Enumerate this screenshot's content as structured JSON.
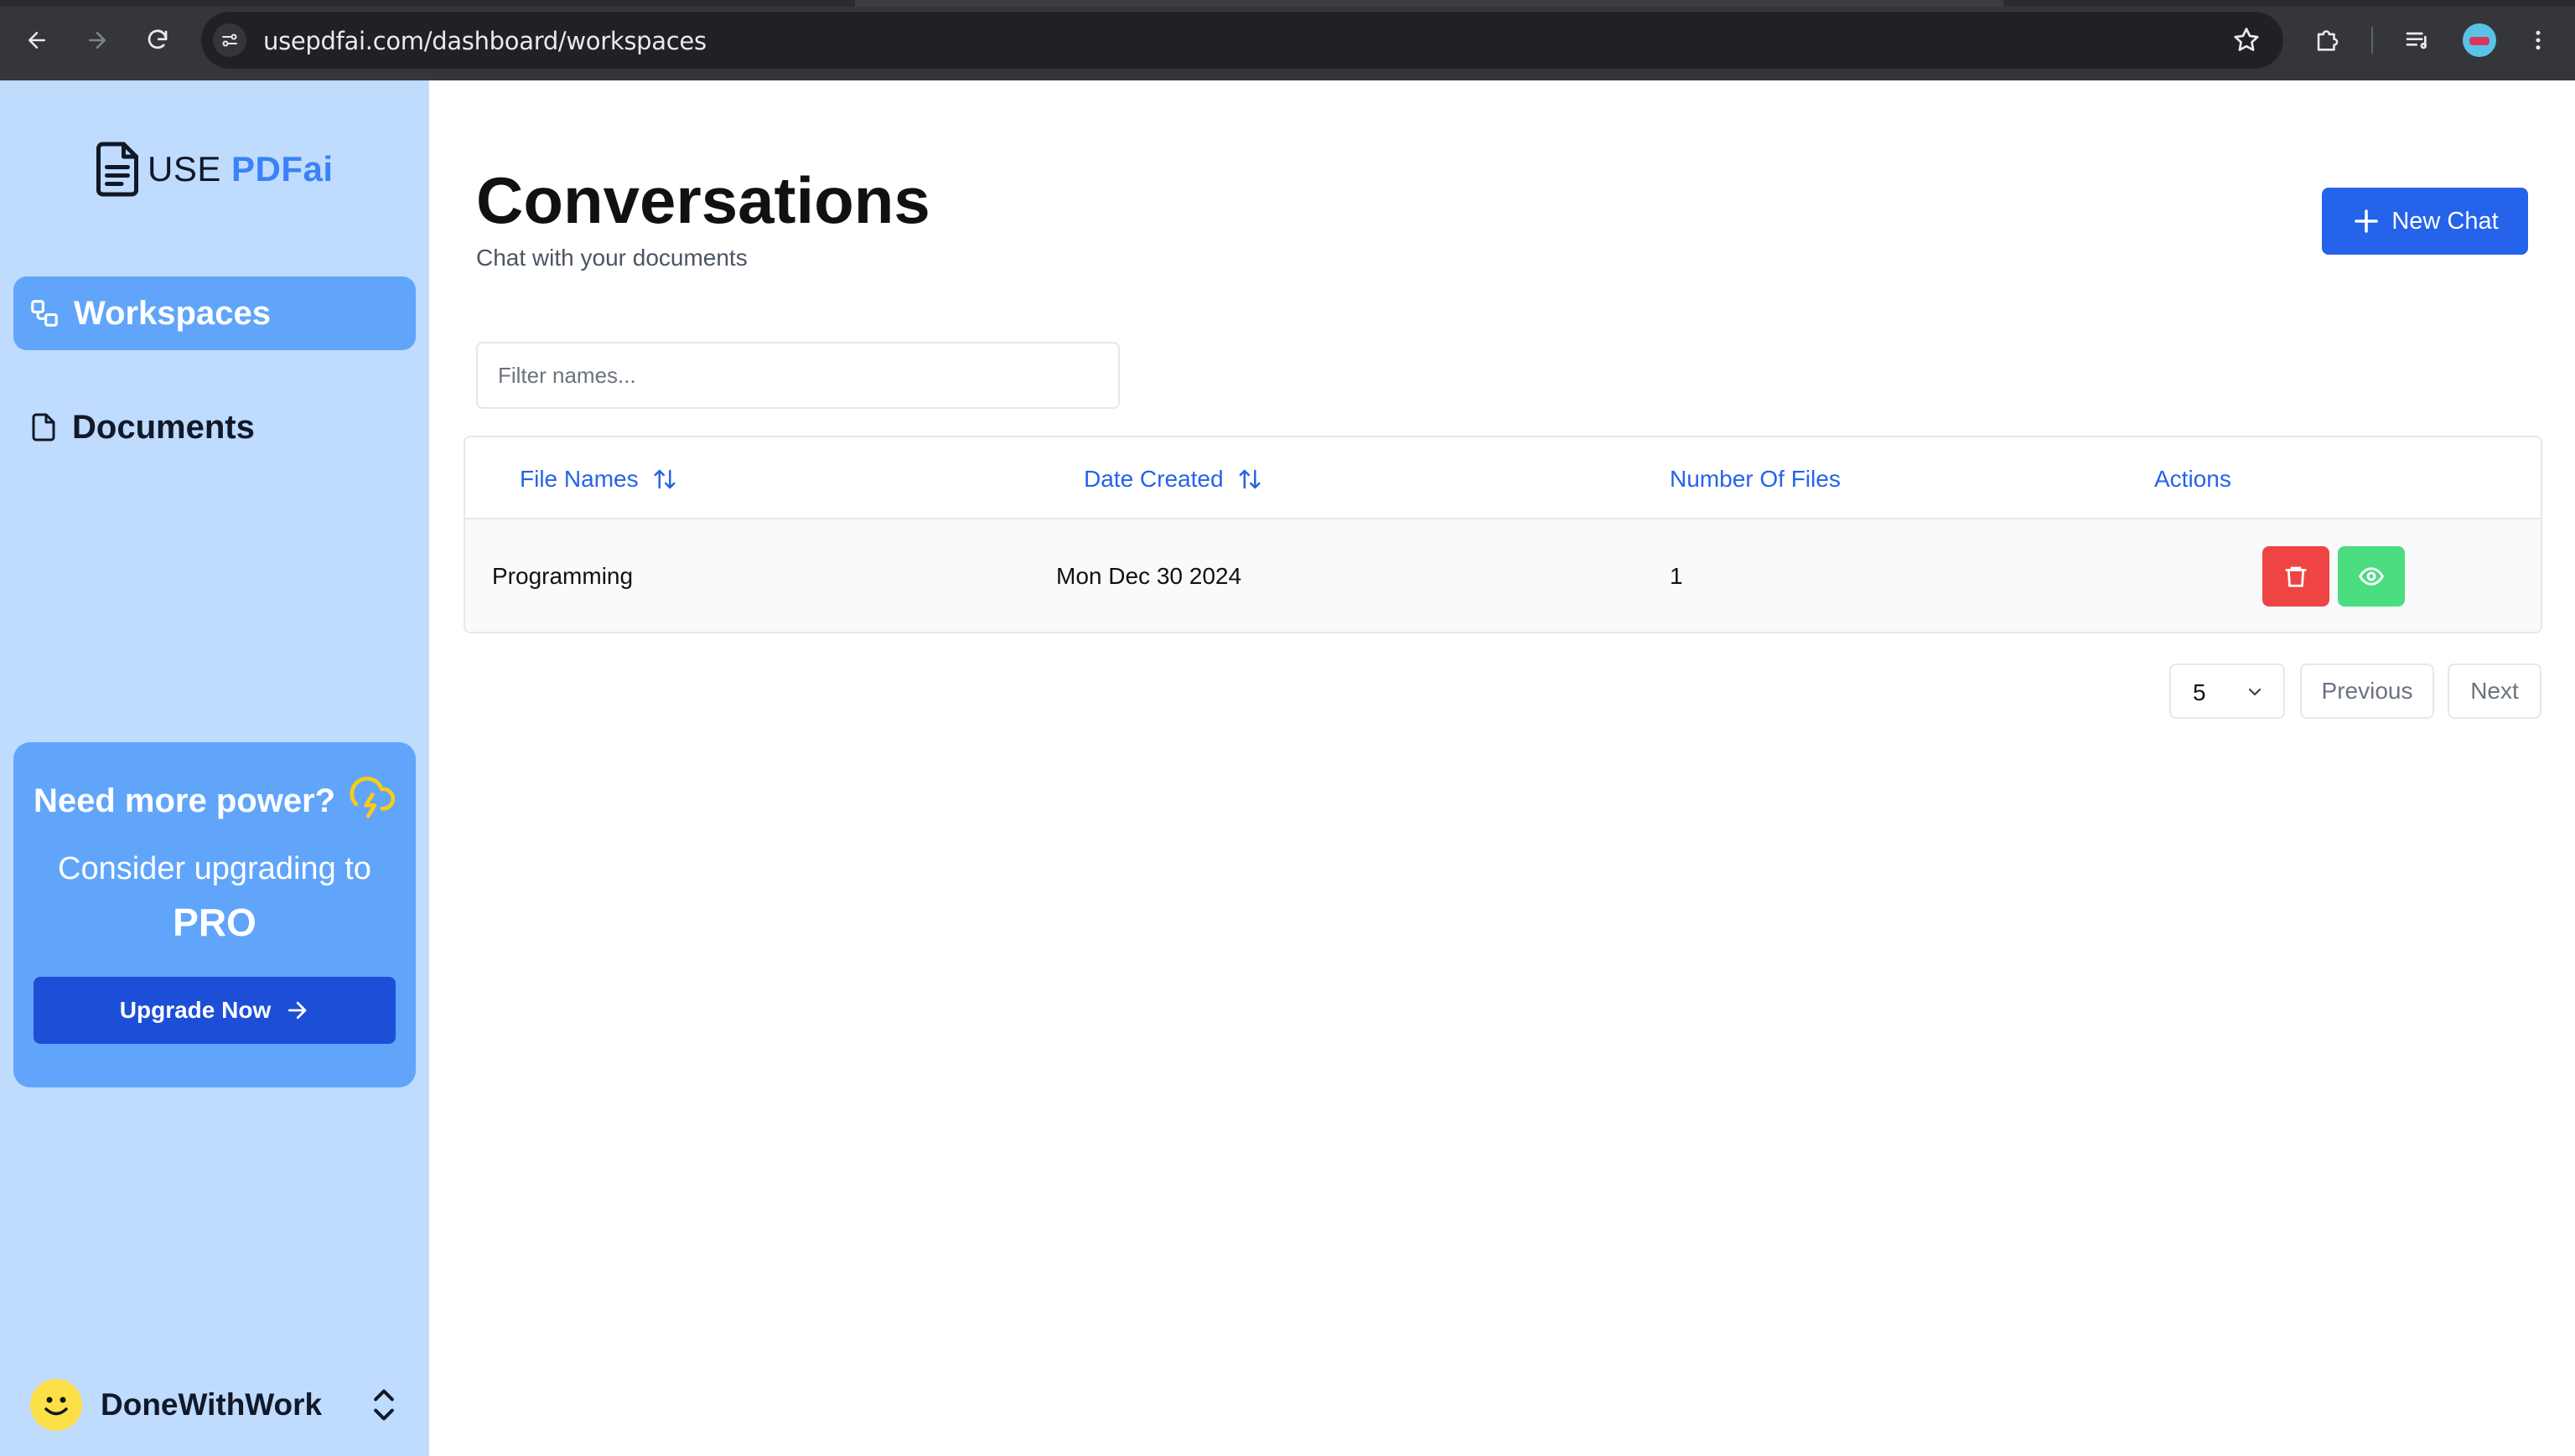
{
  "browser": {
    "url": "usepdfai.com/dashboard/workspaces"
  },
  "sidebar": {
    "logo": {
      "prefix": "USE ",
      "accent": "PDFai"
    },
    "items": [
      {
        "label": "Workspaces",
        "icon": "workspaces-icon",
        "active": true
      },
      {
        "label": "Documents",
        "icon": "document-icon",
        "active": false
      }
    ],
    "promo": {
      "title": "Need more power?",
      "subtitle": "Consider upgrading to",
      "plan": "PRO",
      "button": "Upgrade Now"
    },
    "user": {
      "name": "DoneWithWork"
    }
  },
  "main": {
    "title": "Conversations",
    "subtitle": "Chat with your documents",
    "new_chat_label": "New Chat",
    "filter_placeholder": "Filter names...",
    "table": {
      "columns": [
        "File Names",
        "Date Created",
        "Number Of Files",
        "Actions"
      ],
      "rows": [
        {
          "file_name": "Programming",
          "date_created": "Mon Dec 30 2024",
          "number_of_files": "1"
        }
      ]
    },
    "pagination": {
      "page_size": "5",
      "previous_label": "Previous",
      "next_label": "Next"
    }
  },
  "colors": {
    "sidebar_bg": "#bfdbfe",
    "accent": "#2563eb",
    "active_nav": "#60a5fa",
    "delete": "#ef4444",
    "view": "#4ade80"
  }
}
